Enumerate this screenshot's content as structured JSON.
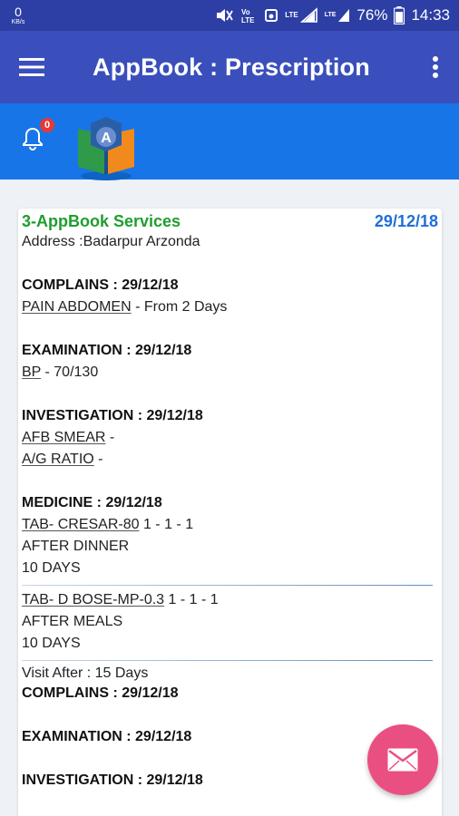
{
  "status_bar": {
    "net_speed": "0",
    "net_unit": "KB/s",
    "lte1": "LTE",
    "lte2": "LTE",
    "battery": "76%",
    "time": "14:33"
  },
  "app_bar": {
    "title": "AppBook : Prescription"
  },
  "notifications": {
    "count": "0"
  },
  "prescription": {
    "service": "3-AppBook Services",
    "date": "29/12/18",
    "address": "Address :Badarpur Arzonda",
    "complains_heading": "COMPLAINS : 29/12/18",
    "complain_item": "PAIN ABDOMEN",
    "complain_detail": " - From 2 Days",
    "examination_heading": "EXAMINATION : 29/12/18",
    "exam_item": "BP",
    "exam_detail": " - 70/130",
    "investigation_heading": "INVESTIGATION : 29/12/18",
    "investigations": [
      {
        "name": "AFB SMEAR",
        "suffix": " -"
      },
      {
        "name": "A/G RATIO",
        "suffix": " -"
      }
    ],
    "medicine_heading": "MEDICINE : 29/12/18",
    "medicines": [
      {
        "name": "TAB- CRESAR-80",
        "dose": " 1 - 1 - 1",
        "instruction": "AFTER DINNER",
        "duration": "10 DAYS"
      },
      {
        "name": "TAB- D BOSE-MP-0.3",
        "dose": " 1 - 1 - 1",
        "instruction": "AFTER MEALS",
        "duration": "10 DAYS"
      }
    ],
    "visit_after": "Visit After : 15 Days",
    "complains_heading_2": "COMPLAINS : 29/12/18",
    "examination_heading_2": "EXAMINATION : 29/12/18",
    "investigation_heading_2": "INVESTIGATION : 29/12/18"
  },
  "colors": {
    "status_bar": "#2d3fa4",
    "app_bar": "#3a4fbb",
    "sub_bar": "#1875e8",
    "service_green": "#1f9d2e",
    "date_blue": "#1e6fd9",
    "fab_pink": "#ea4f82"
  },
  "icons": {
    "menu": "hamburger-icon",
    "more": "more-vert-icon",
    "bell": "bell-icon",
    "fab": "mail-icon"
  }
}
